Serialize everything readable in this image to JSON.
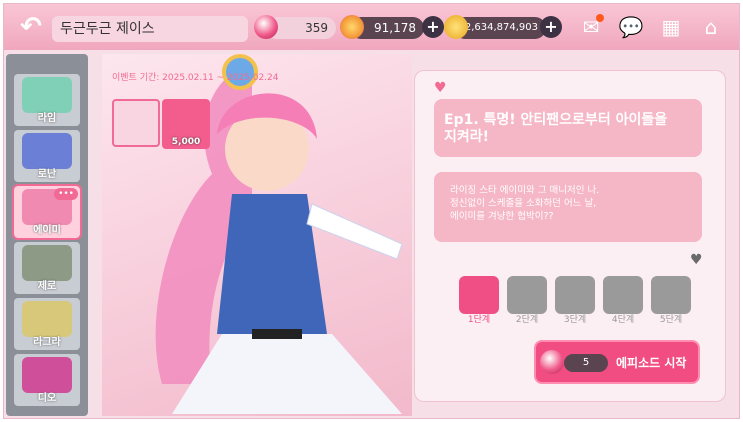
{
  "header": {
    "title": "두근두근 제이스",
    "gem_count": "359",
    "coin_count": "91,178",
    "gold_count": "12,634,874,903"
  },
  "sidebar": {
    "items": [
      {
        "label": "라임"
      },
      {
        "label": "로난"
      },
      {
        "label": "에이미",
        "badge": "•••"
      },
      {
        "label": "제로"
      },
      {
        "label": "라그라"
      },
      {
        "label": "디오"
      }
    ]
  },
  "event": {
    "period": "이벤트 기간: 2025.02.11 ~ 2025.02.24",
    "reward_value": "5,000"
  },
  "episode": {
    "title": "Ep1. 특명! 안티팬으로부터 아이돌을 지켜라!",
    "description": "라이징 스타 에이미와 그 매니저인 나.\n정신없이 스케줄을 소화하던 어느 날,\n에이미를 겨냥한 협박이??"
  },
  "steps": [
    {
      "label": "1단계",
      "locked": false
    },
    {
      "label": "2단계",
      "locked": true
    },
    {
      "label": "3단계",
      "locked": true
    },
    {
      "label": "4단계",
      "locked": true
    },
    {
      "label": "5단계",
      "locked": true
    }
  ],
  "start": {
    "cost": "5",
    "label": "에피소드 시작"
  },
  "colors": {
    "accent": "#f24d83",
    "bubble": "#f5b6c6"
  }
}
